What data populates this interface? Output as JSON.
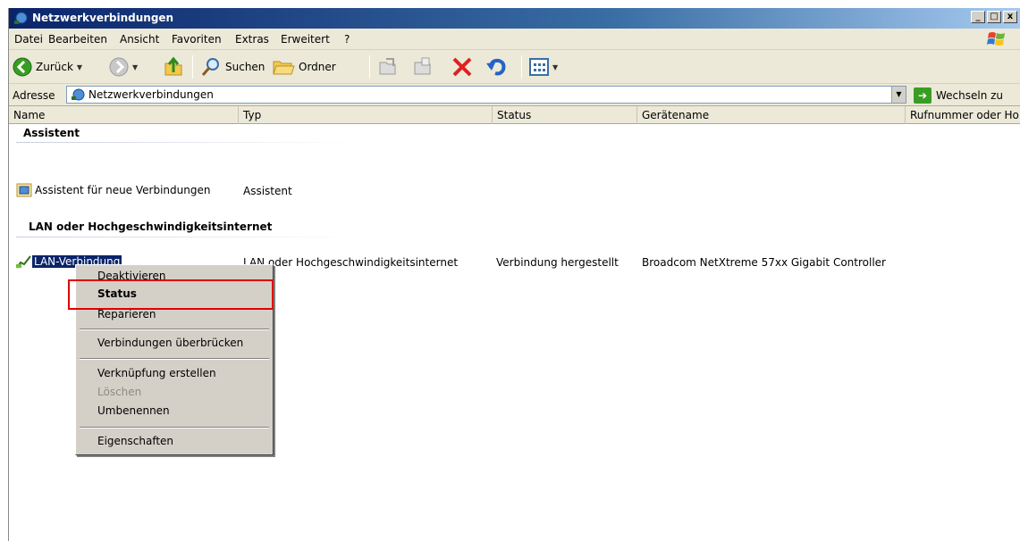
{
  "window": {
    "title": "Netzwerkverbindungen"
  },
  "menu": [
    "Datei",
    "Bearbeiten",
    "Ansicht",
    "Favoriten",
    "Extras",
    "Erweitert",
    "?"
  ],
  "toolbar": {
    "back": "Zurück",
    "search": "Suchen",
    "folders": "Ordner"
  },
  "address": {
    "label": "Adresse",
    "value": "Netzwerkverbindungen",
    "go": "Wechseln zu"
  },
  "columns": [
    "Name",
    "Typ",
    "Status",
    "Gerätename",
    "Rufnummer oder Ho"
  ],
  "groups": [
    {
      "title": "Assistent",
      "items": [
        {
          "name": "Assistent für neue Verbindungen",
          "type": "Assistent"
        }
      ]
    },
    {
      "title": "LAN oder Hochgeschwindigkeitsinternet",
      "items": [
        {
          "name": "LAN-Verbindung",
          "type": "LAN oder Hochgeschwindigkeitsinternet",
          "status": "Verbindung hergestellt",
          "device": "Broadcom NetXtreme 57xx Gigabit Controller"
        }
      ]
    }
  ],
  "context_menu": {
    "deactivate": "Deaktivieren",
    "status": "Status",
    "repair": "Reparieren",
    "bridge": "Verbindungen überbrücken",
    "shortcut": "Verknüpfung erstellen",
    "delete": "Löschen",
    "rename": "Umbenennen",
    "properties": "Eigenschaften"
  },
  "colors": {
    "highlight": "#e00000",
    "selection": "#0a246a",
    "title_gradient_start": "#0a246a"
  }
}
